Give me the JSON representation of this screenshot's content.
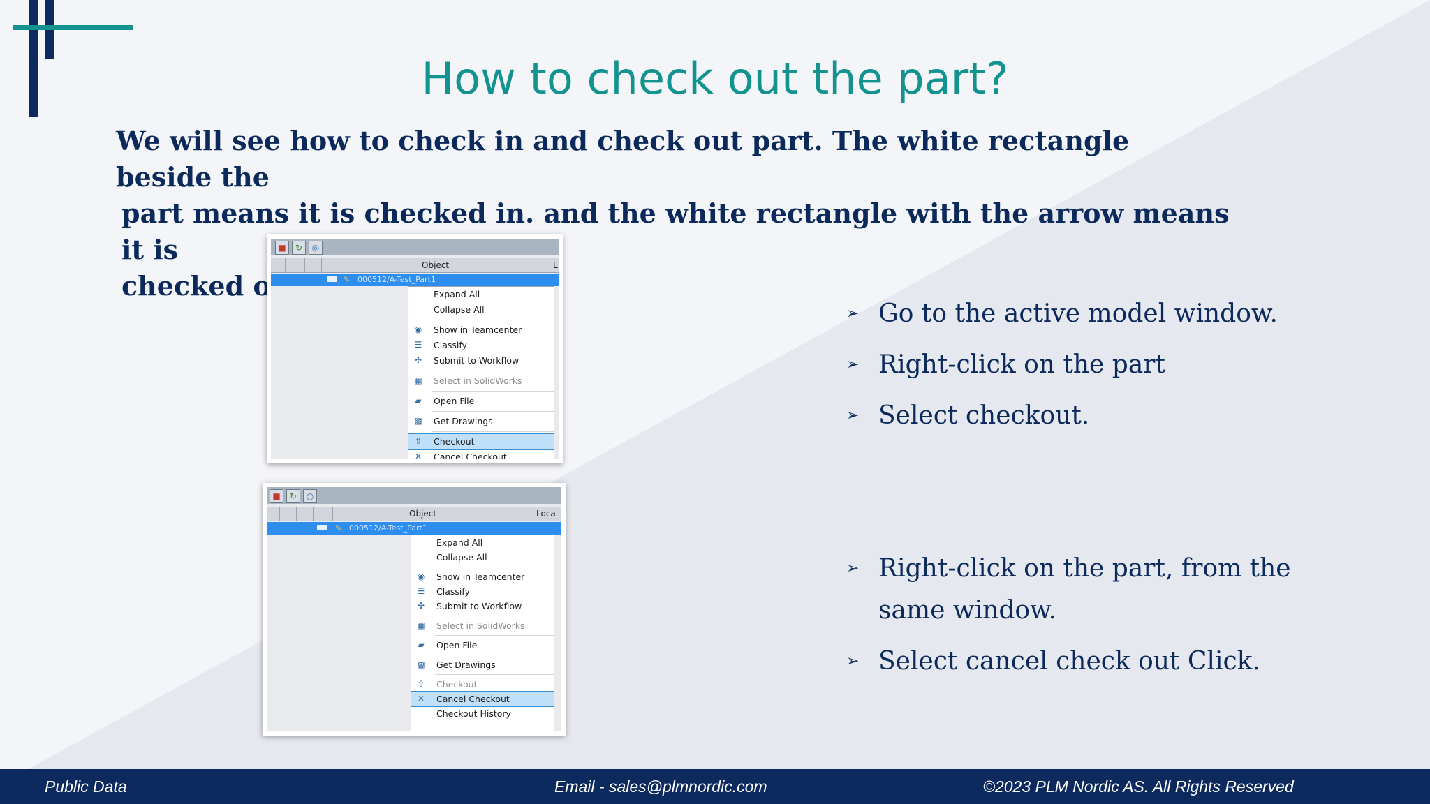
{
  "slide": {
    "title": "How to check out the part?",
    "intro": [
      "We will see how to check in and check out part. The white rectangle beside the",
      "part means it is checked in. and the white rectangle with the arrow means it is",
      "checked out."
    ],
    "bullets_checkout": [
      "Go to the active model window.",
      "Right-click on the part",
      "Select checkout."
    ],
    "bullets_cancel": [
      "Right-click on the part, from the",
      "same window.",
      "Select cancel check out Click."
    ],
    "arrow_glyph": "➢"
  },
  "screenshot_checkout": {
    "toolbar_icons": [
      "cube-icon",
      "refresh-icon",
      "globe-icon"
    ],
    "column_header": "Object",
    "column_header_right": "L",
    "selected_item": "000512/A-Test_Part1",
    "menu": [
      {
        "label": "Expand All",
        "icon": "",
        "state": "normal"
      },
      {
        "label": "Collapse All",
        "icon": "",
        "state": "normal"
      },
      {
        "label": "Show in Teamcenter",
        "icon": "globe-icon",
        "state": "normal"
      },
      {
        "label": "Classify",
        "icon": "classify-icon",
        "state": "normal"
      },
      {
        "label": "Submit to Workflow",
        "icon": "workflow-icon",
        "state": "normal"
      },
      {
        "label": "Select in SolidWorks",
        "icon": "solidworks-icon",
        "state": "disabled"
      },
      {
        "label": "Open File",
        "icon": "folder-icon",
        "state": "normal"
      },
      {
        "label": "Get Drawings",
        "icon": "drawings-icon",
        "state": "normal"
      },
      {
        "label": "Checkout",
        "icon": "checkout-icon",
        "state": "highlighted"
      },
      {
        "label": "Cancel Checkout",
        "icon": "cancel-icon",
        "state": "cut-off"
      }
    ]
  },
  "screenshot_cancel": {
    "toolbar_icons": [
      "cube-icon",
      "refresh-icon",
      "globe-icon"
    ],
    "column_header": "Object",
    "column_header_right": "Loca",
    "selected_item": "000512/A-Test_Part1",
    "menu": [
      {
        "label": "Expand All",
        "icon": "",
        "state": "normal"
      },
      {
        "label": "Collapse All",
        "icon": "",
        "state": "normal"
      },
      {
        "label": "Show in Teamcenter",
        "icon": "globe-icon",
        "state": "normal"
      },
      {
        "label": "Classify",
        "icon": "classify-icon",
        "state": "normal"
      },
      {
        "label": "Submit to Workflow",
        "icon": "workflow-icon",
        "state": "normal"
      },
      {
        "label": "Select in SolidWorks",
        "icon": "solidworks-icon",
        "state": "disabled"
      },
      {
        "label": "Open File",
        "icon": "folder-icon",
        "state": "normal"
      },
      {
        "label": "Get Drawings",
        "icon": "drawings-icon",
        "state": "normal"
      },
      {
        "label": "Checkout",
        "icon": "checkout-icon",
        "state": "disabled"
      },
      {
        "label": "Cancel Checkout",
        "icon": "cancel-icon",
        "state": "highlighted"
      },
      {
        "label": "Checkout History",
        "icon": "",
        "state": "normal"
      }
    ]
  },
  "footer": {
    "left": "Public Data",
    "center": "Email - sales@plmnordic.com",
    "right": "©2023 PLM Nordic AS. All Rights Reserved"
  },
  "colors": {
    "navy": "#0d2a5e",
    "teal": "#13938f",
    "text": "#0b2a5b",
    "selection": "#2e8ef0",
    "menu_highlight": "#bfe0f8"
  }
}
